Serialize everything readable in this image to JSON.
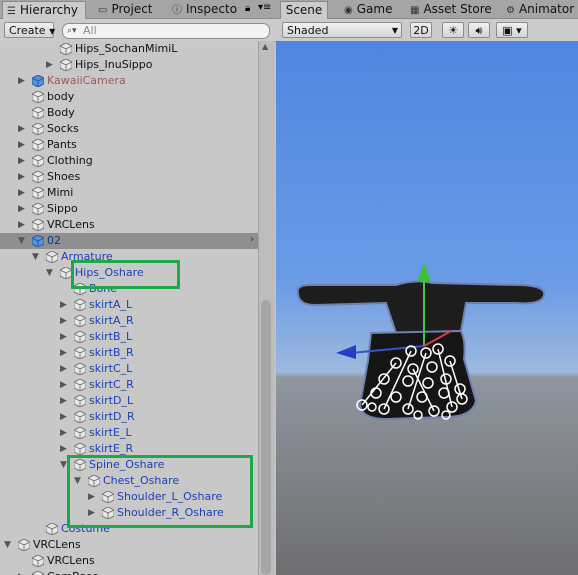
{
  "hierarchy_tabs": [
    {
      "label": "Hierarchy",
      "icon": "list-icon",
      "active": true
    },
    {
      "label": "Project",
      "icon": "folder-icon",
      "active": false
    },
    {
      "label": "Inspecto",
      "icon": "info-icon",
      "active": false
    }
  ],
  "scene_tabs": [
    {
      "label": "Scene",
      "icon": "grid-icon",
      "active": true
    },
    {
      "label": "Game",
      "icon": "gamepad-icon",
      "active": false
    },
    {
      "label": "Asset Store",
      "icon": "store-icon",
      "active": false
    },
    {
      "label": "Animator",
      "icon": "animator-icon",
      "active": false
    }
  ],
  "hierarchy_toolbar": {
    "create_label": "Create",
    "search_placeholder": "All"
  },
  "scene_toolbar": {
    "shading_mode": "Shaded",
    "mode_2d": "2D"
  },
  "tree": [
    {
      "label": "Hips_SochanMimiL",
      "indent": 4,
      "arrow": "",
      "style": ""
    },
    {
      "label": "Hips_InuSippo",
      "indent": 4,
      "arrow": "right",
      "style": ""
    },
    {
      "label": "KawaiiCamera",
      "indent": 2,
      "arrow": "right",
      "style": "pink"
    },
    {
      "label": "body",
      "indent": 2,
      "arrow": "",
      "style": ""
    },
    {
      "label": "Body",
      "indent": 2,
      "arrow": "",
      "style": ""
    },
    {
      "label": "Socks",
      "indent": 2,
      "arrow": "right",
      "style": ""
    },
    {
      "label": "Pants",
      "indent": 2,
      "arrow": "right",
      "style": ""
    },
    {
      "label": "Clothing",
      "indent": 2,
      "arrow": "right",
      "style": ""
    },
    {
      "label": "Shoes",
      "indent": 2,
      "arrow": "right",
      "style": ""
    },
    {
      "label": "Mimi",
      "indent": 2,
      "arrow": "right",
      "style": ""
    },
    {
      "label": "Sippo",
      "indent": 2,
      "arrow": "right",
      "style": ""
    },
    {
      "label": "VRCLens",
      "indent": 2,
      "arrow": "right",
      "style": ""
    },
    {
      "label": "02",
      "indent": 2,
      "arrow": "down",
      "style": "sel"
    },
    {
      "label": "Armature",
      "indent": 3,
      "arrow": "down",
      "style": "blue"
    },
    {
      "label": "Hips_Oshare",
      "indent": 4,
      "arrow": "down",
      "style": "blue"
    },
    {
      "label": "Bone",
      "indent": 5,
      "arrow": "",
      "style": "blue"
    },
    {
      "label": "skirtA_L",
      "indent": 5,
      "arrow": "right",
      "style": "blue"
    },
    {
      "label": "skirtA_R",
      "indent": 5,
      "arrow": "right",
      "style": "blue"
    },
    {
      "label": "skirtB_L",
      "indent": 5,
      "arrow": "right",
      "style": "blue"
    },
    {
      "label": "skirtB_R",
      "indent": 5,
      "arrow": "right",
      "style": "blue"
    },
    {
      "label": "skirtC_L",
      "indent": 5,
      "arrow": "right",
      "style": "blue"
    },
    {
      "label": "skirtC_R",
      "indent": 5,
      "arrow": "right",
      "style": "blue"
    },
    {
      "label": "skirtD_L",
      "indent": 5,
      "arrow": "right",
      "style": "blue"
    },
    {
      "label": "skirtD_R",
      "indent": 5,
      "arrow": "right",
      "style": "blue"
    },
    {
      "label": "skirtE_L",
      "indent": 5,
      "arrow": "right",
      "style": "blue"
    },
    {
      "label": "skirtE_R",
      "indent": 5,
      "arrow": "right",
      "style": "blue"
    },
    {
      "label": "Spine_Oshare",
      "indent": 5,
      "arrow": "down",
      "style": "blue"
    },
    {
      "label": "Chest_Oshare",
      "indent": 6,
      "arrow": "down",
      "style": "blue"
    },
    {
      "label": "Shoulder_L_Oshare",
      "indent": 7,
      "arrow": "right",
      "style": "blue"
    },
    {
      "label": "Shoulder_R_Oshare",
      "indent": 7,
      "arrow": "right",
      "style": "blue"
    },
    {
      "label": "Costume",
      "indent": 3,
      "arrow": "",
      "style": "blue"
    },
    {
      "label": "VRCLens",
      "indent": 1,
      "arrow": "down",
      "style": ""
    },
    {
      "label": "VRCLens",
      "indent": 2,
      "arrow": "",
      "style": ""
    },
    {
      "label": "CamBase",
      "indent": 2,
      "arrow": "right",
      "style": ""
    }
  ],
  "colors": {
    "highlight_box": "#1fa84a",
    "linked_label": "#1a3fb8",
    "selection": "#8f8f8f"
  }
}
